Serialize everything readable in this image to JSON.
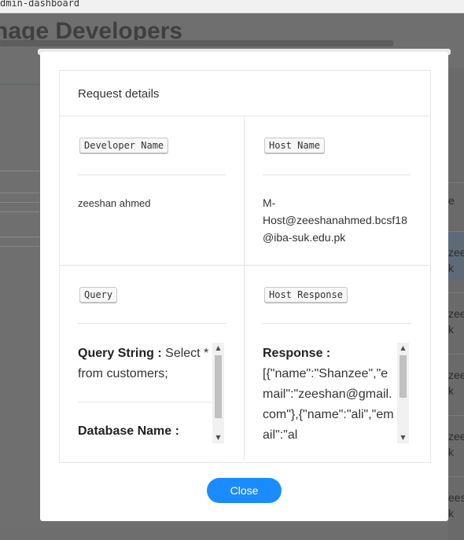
{
  "browser": {
    "url_fragment": "dmin-dashboard"
  },
  "background_page": {
    "title": "nage Developers",
    "right_column_fragments": [
      "e",
      "zee",
      "k",
      "zee",
      "k",
      "zee",
      "k",
      "zee",
      "k",
      "ees",
      "k"
    ]
  },
  "modal": {
    "title": "Request details",
    "developer_label": "Developer Name",
    "developer_value": "zeeshan ahmed",
    "host_label": "Host Name",
    "host_value_lines": [
      "M-",
      "Host@zeeshanahmed.bcsf18",
      "@iba-suk.edu.pk"
    ],
    "query_label": "Query",
    "query_string_label": "Query String :",
    "query_string_value": "Select * from customers;",
    "database_name_label": "Database Name :",
    "host_response_label": "Host Response",
    "response_label": "Response :",
    "response_value": "[{\"name\":\"Shanzee\",\"email\":\"zeeshan@gmail.com\"},{\"name\":\"ali\",\"email\":\"al",
    "close_button": "Close"
  },
  "colors": {
    "accent": "#1a8cff",
    "backdrop": "#6f6f6f"
  },
  "icons": {
    "scroll_up": "triangle-up",
    "scroll_down": "triangle-down"
  }
}
